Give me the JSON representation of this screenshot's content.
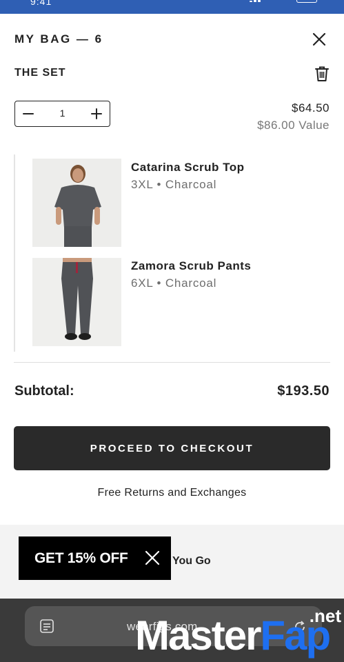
{
  "status_bar": {
    "time": "9:41"
  },
  "header": {
    "title": "MY BAG — 6"
  },
  "set": {
    "title": "THE SET",
    "quantity": "1",
    "price": "$64.50",
    "value": "$86.00 Value"
  },
  "items": [
    {
      "name": "Catarina Scrub Top",
      "meta": "3XL • Charcoal"
    },
    {
      "name": "Zamora Scrub Pants",
      "meta": "6XL • Charcoal"
    }
  ],
  "summary": {
    "subtotal_label": "Subtotal:",
    "subtotal_value": "$193.50"
  },
  "checkout": {
    "label": "PROCEED TO CHECKOUT"
  },
  "returns": {
    "text": "Free Returns and Exchanges"
  },
  "promo": {
    "banner_label": "GET 15% OFF",
    "strip_text": "You Go"
  },
  "browser": {
    "url": "wearfigs.com"
  },
  "watermark": {
    "main": "Master",
    "accent": "Fap",
    "suffix": ".net"
  },
  "colors": {
    "status_bar": "#2f5fb4",
    "checkout_button": "#2a2a2a",
    "discount_banner": "#000000",
    "browser_chrome": "#3a3a3a",
    "watermark_accent": "#1e6ff0"
  },
  "icons": [
    "close-icon",
    "trash-icon",
    "minus-icon",
    "plus-icon",
    "tabs-icon",
    "reload-icon"
  ]
}
